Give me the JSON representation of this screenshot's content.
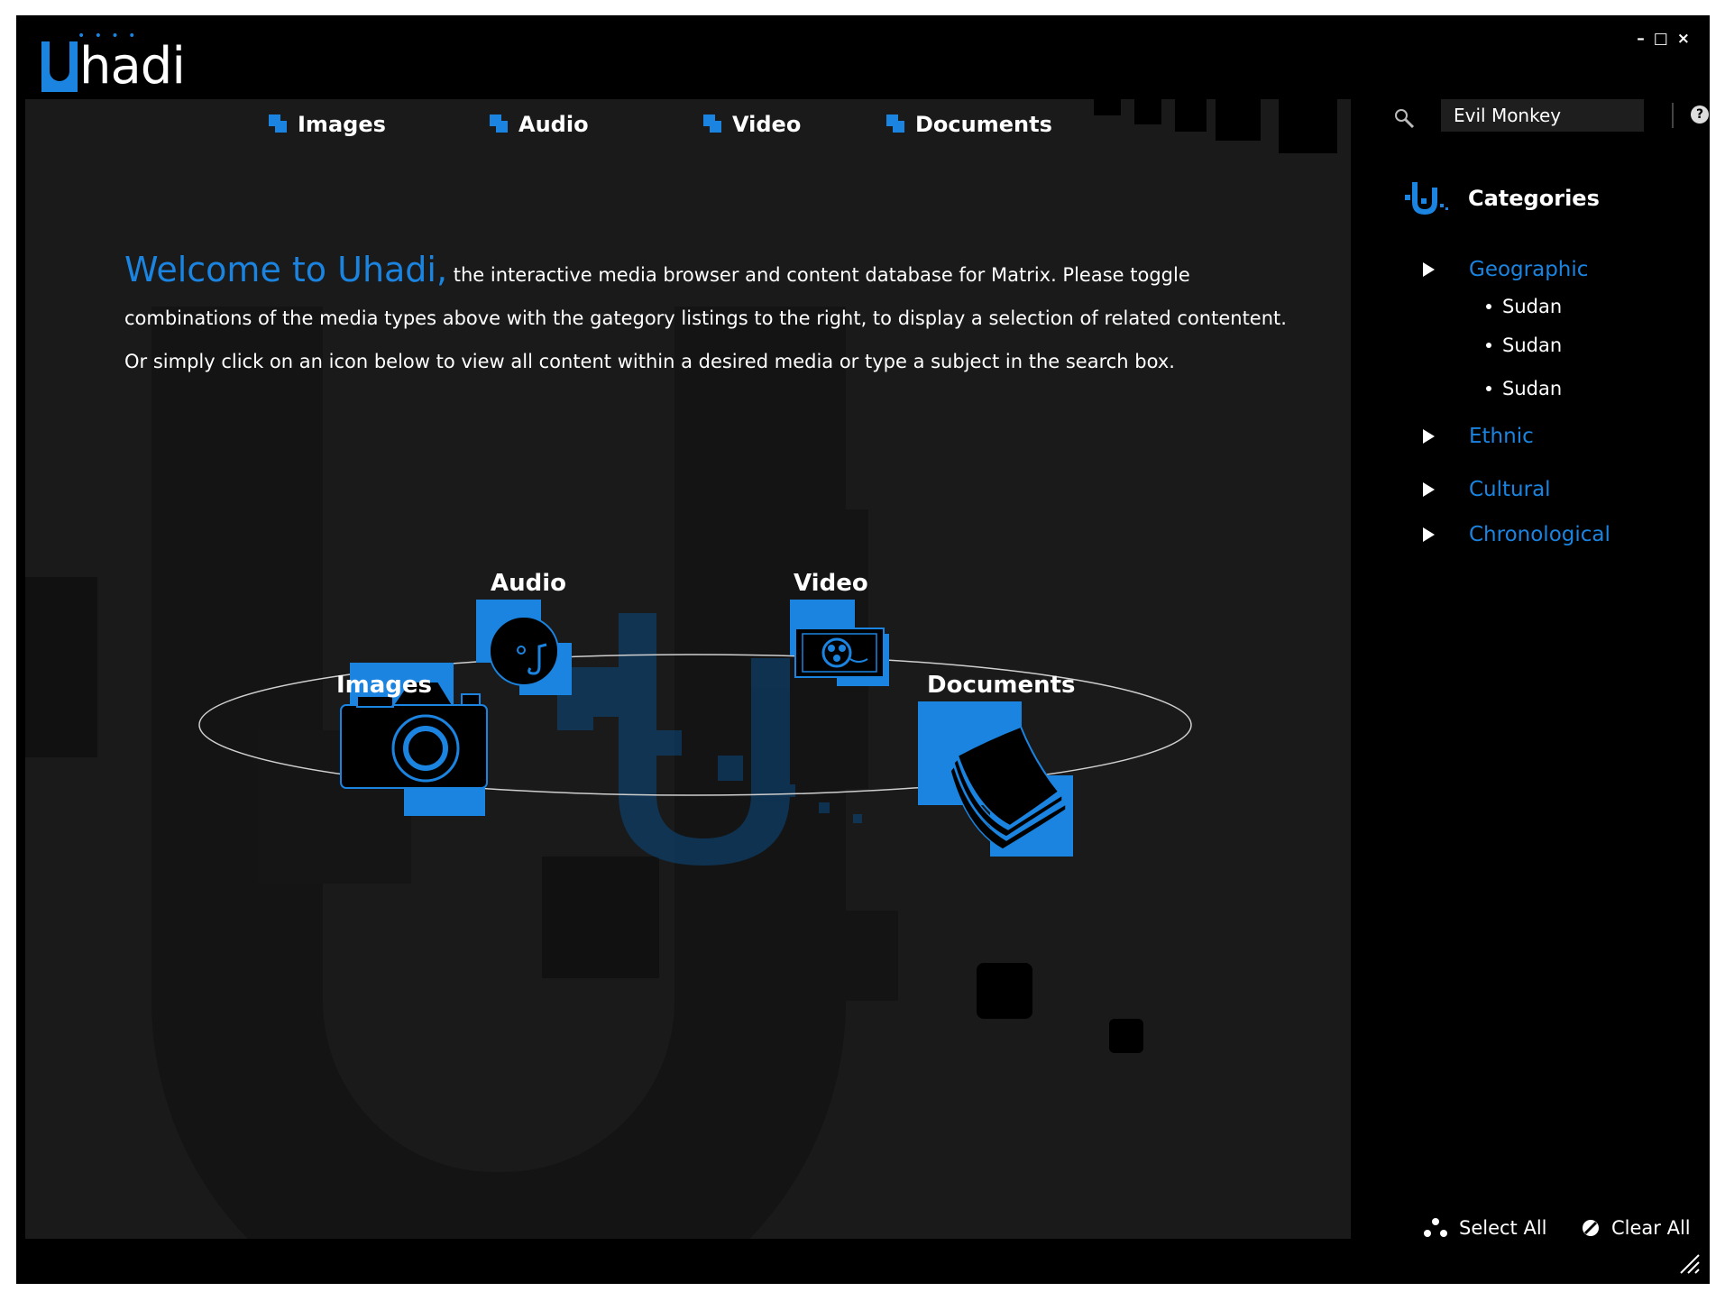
{
  "app": {
    "logo_letter": "U",
    "logo_rest": "hadi"
  },
  "window_controls": {
    "minimize": "–",
    "maximize": "□",
    "close": "×"
  },
  "nav": [
    {
      "label": "Images"
    },
    {
      "label": "Audio"
    },
    {
      "label": "Video"
    },
    {
      "label": "Documents"
    }
  ],
  "intro": {
    "welcome": "Welcome to Uhadi,",
    "text": "the interactive media browser and content database for Matrix.  Please toggle combinations of the media types above with the gategory listings to the right, to display a selection of related contentent.  Or simply click on an icon below to view all content within a desired media or type a subject in the search box."
  },
  "media": {
    "images": "Images",
    "audio": "Audio",
    "video": "Video",
    "documents": "Documents"
  },
  "search": {
    "value": "Evil Monkey"
  },
  "help_label": "?",
  "categories": {
    "title": "Categories",
    "items": [
      {
        "label": "Geographic",
        "children": [
          "Sudan",
          "Sudan",
          "Sudan"
        ]
      },
      {
        "label": "Ethnic"
      },
      {
        "label": "Cultural"
      },
      {
        "label": "Chronological"
      }
    ]
  },
  "footer": {
    "select_all": "Select All",
    "clear_all": "Clear All"
  },
  "colors": {
    "accent": "#1a84e0",
    "background": "#000000",
    "panel": "#1a1a1a"
  }
}
